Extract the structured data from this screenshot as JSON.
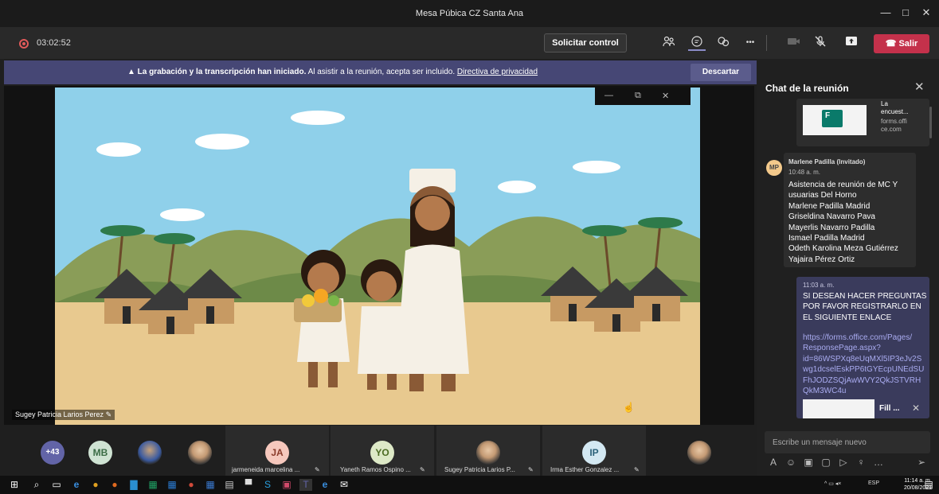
{
  "window": {
    "title": "Mesa Púbica CZ Santa Ana",
    "minimize": "—",
    "maximize": "□",
    "close": "✕"
  },
  "toolbar": {
    "timer": "03:02:52",
    "request_control": "Solicitar control",
    "leave": "Salir",
    "more": "•••"
  },
  "banner": {
    "bold": "La grabación y la transcripción han iniciado.",
    "text": " Al asistir a la reunión, acepta ser incluido. ",
    "link": "Directiva de privacidad",
    "dismiss": "Descartar"
  },
  "stage": {
    "presenter": "Sugey Patricia Larios Perez",
    "video_controls": {
      "minimize": "—",
      "popout": "⧉",
      "close": "✕"
    }
  },
  "chat": {
    "title": "Chat de la reunión",
    "forms_card": {
      "line1": "La",
      "line2": "encuest...",
      "domain1": "forms.offi",
      "domain2": "ce.com"
    },
    "message1": {
      "avatar": "MP",
      "sender": "Marlene Padilla (Invitado)",
      "time": "10:48 a. m.",
      "lines": [
        "Asistencia de reunión de MC Y",
        "usuarias Del Horno",
        "Marlene Padilla Madrid",
        "Griseldina Navarro Pava",
        "Mayerlis Navarro Padilla",
        "Ismael Padilla Madrid",
        "Odeth Karolina Meza Gutiérrez",
        "Yajaira Pérez Ortiz"
      ]
    },
    "message2": {
      "time": "11:03 a. m.",
      "lines": [
        "SI DESEAN HACER PREGUNTAS",
        "POR FAVOR REGISTRARLO EN",
        "EL SIGUIENTE ENLACE"
      ],
      "link_lines": [
        "https://forms.office.com/Pages/",
        "ResponsePage.aspx?",
        "id=86WSPXq8eUqMXl5IP3eJv2S",
        "wg1dcselEskPP6tGYEcpUNEdSU",
        "FhJODZSQjAwWVY2QkJSTVRH",
        "QkM3WC4u"
      ],
      "fill_label": "Fill ..."
    },
    "compose_placeholder": "Escribe un mensaje nuevo"
  },
  "participants": {
    "more": "+43",
    "tiles": [
      {
        "initials": "MB",
        "color": "#cfe3d3",
        "text_color": "#3a6b45"
      },
      {
        "initials": "JA",
        "color": "#f6c8bd",
        "text_color": "#8a3b2a",
        "label": "jarmeneida marcelina ..."
      },
      {
        "initials": "YO",
        "color": "#dde9c7",
        "text_color": "#4b6b22",
        "label": "Yaneth Ramos Ospino ..."
      },
      {
        "label": "Sugey Patricia Larios P..."
      },
      {
        "initials": "IP",
        "color": "#d3e8f2",
        "text_color": "#2a6179",
        "label": "Irma Esther Gonzalez ..."
      }
    ]
  },
  "taskbar": {
    "time": "11:14 a. m.",
    "date": "20/08/2021",
    "lang": "ESP"
  }
}
